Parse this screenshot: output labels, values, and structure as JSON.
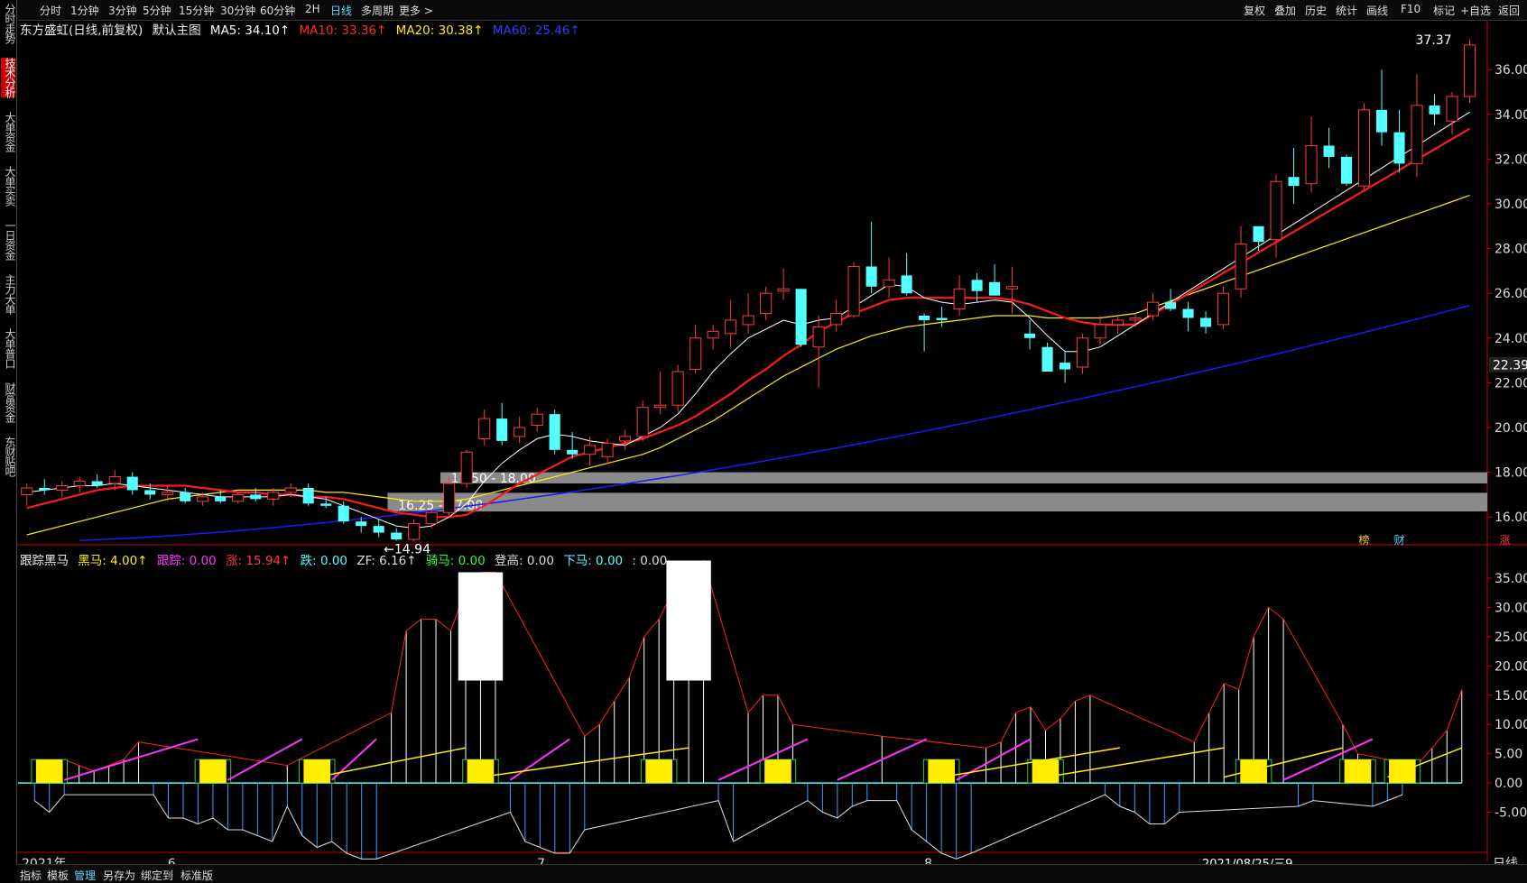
{
  "toolbar": {
    "left": [
      "分时",
      "1分钟",
      "3分钟",
      "5分钟",
      "15分钟",
      "30分钟",
      "60分钟",
      "2H",
      "日线",
      "多周期",
      "更多 >"
    ],
    "active": "日线",
    "right": [
      "复权",
      "叠加",
      "历史",
      "统计",
      "画线",
      "F10",
      "标记",
      "+自选",
      "返回"
    ]
  },
  "sidebar": {
    "items": [
      "分时走势",
      "技术分析",
      "大单资金",
      "大单买卖",
      "一日资金",
      "主力大单",
      "大单普口",
      "财富资金",
      "东财贴吧"
    ],
    "active": "技术分析"
  },
  "main_info": {
    "name": "东方盛虹(日线,前复权)",
    "template": "默认主图",
    "ma5_label": "MA5: 34.10↑",
    "ma10_label": "MA10: 33.36↑",
    "ma20_label": "MA20: 30.38↑",
    "ma60_label": "MA60: 25.46↑"
  },
  "indicator_info": {
    "name": "跟踪黑马",
    "heima": "黑马: 4.00↑",
    "genzong": "跟踪: 0.00",
    "zhang": "涨: 15.94↑",
    "die": "跌: 0.00",
    "zf": "ZF: 6.16↑",
    "qima": "骑马: 0.00",
    "denggao": "登高: 0.00",
    "xiama": "下马: 0.00",
    "blank": ": 0.00"
  },
  "bottom_bar": {
    "items": [
      "指标",
      "模板",
      "管理",
      "另存为",
      "绑定到",
      "标准版"
    ],
    "active": "管理"
  },
  "colors": {
    "up": "#ff3b3b",
    "down": "#54ffff",
    "ma5": "#ffffff",
    "ma10": "#ff1a1a",
    "ma20": "#ffee00",
    "ma60": "#1a1aff",
    "bg": "#000000"
  },
  "chart_data": [
    {
      "type": "candlestick",
      "title": "东方盛虹(日线,前复权)",
      "y_ticks": [
        16,
        18,
        20,
        22,
        24,
        26,
        28,
        30,
        32,
        34,
        36
      ],
      "current_price_label": "22.39",
      "high_label": "37.37",
      "low_label": "←14.94",
      "zone_labels": [
        "17.50 - 18.00",
        "16.25 - 17.08"
      ],
      "zones": [
        [
          17.5,
          18.0
        ],
        [
          16.25,
          17.08
        ]
      ],
      "x_labels": [
        "2021年",
        "6",
        "7",
        "8",
        "2021/08/25/三9"
      ],
      "x_label_index": [
        0,
        8,
        29,
        51,
        66
      ],
      "event_marks": [
        "榜",
        "财",
        "涨"
      ],
      "ohlc": [
        [
          17.0,
          17.5,
          16.5,
          17.3
        ],
        [
          17.3,
          17.7,
          17.0,
          17.2
        ],
        [
          17.2,
          17.6,
          16.9,
          17.4
        ],
        [
          17.4,
          17.8,
          17.1,
          17.6
        ],
        [
          17.6,
          17.9,
          17.3,
          17.4
        ],
        [
          17.5,
          18.1,
          17.2,
          17.8
        ],
        [
          17.8,
          18.0,
          17.0,
          17.2
        ],
        [
          17.2,
          17.5,
          16.8,
          17.0
        ],
        [
          17.0,
          17.4,
          16.7,
          17.1
        ],
        [
          17.1,
          17.3,
          16.6,
          16.7
        ],
        [
          16.7,
          17.1,
          16.5,
          16.9
        ],
        [
          16.9,
          17.2,
          16.6,
          16.7
        ],
        [
          16.7,
          17.1,
          16.6,
          17.0
        ],
        [
          17.0,
          17.3,
          16.7,
          16.8
        ],
        [
          16.8,
          17.3,
          16.5,
          17.1
        ],
        [
          17.1,
          17.5,
          16.9,
          17.3
        ],
        [
          17.3,
          17.5,
          16.5,
          16.6
        ],
        [
          16.6,
          16.9,
          16.4,
          16.5
        ],
        [
          16.5,
          16.7,
          15.7,
          15.8
        ],
        [
          15.8,
          16.0,
          15.3,
          15.6
        ],
        [
          15.6,
          15.9,
          15.1,
          15.3
        ],
        [
          15.3,
          15.5,
          14.94,
          15.0
        ],
        [
          15.0,
          15.9,
          14.9,
          15.7
        ],
        [
          15.7,
          16.3,
          15.5,
          16.2
        ],
        [
          16.2,
          17.8,
          16.0,
          17.5
        ],
        [
          17.5,
          19.0,
          17.3,
          18.9
        ],
        [
          19.5,
          20.8,
          19.2,
          20.4
        ],
        [
          20.4,
          21.1,
          19.2,
          19.4
        ],
        [
          19.6,
          20.5,
          19.3,
          20.0
        ],
        [
          20.1,
          20.9,
          19.8,
          20.6
        ],
        [
          20.6,
          20.8,
          18.8,
          19.0
        ],
        [
          19.0,
          19.8,
          18.6,
          18.8
        ],
        [
          18.8,
          19.6,
          18.3,
          19.2
        ],
        [
          18.7,
          19.5,
          18.4,
          19.3
        ],
        [
          19.4,
          19.9,
          19.0,
          19.6
        ],
        [
          19.6,
          21.2,
          19.4,
          20.9
        ],
        [
          20.9,
          22.5,
          20.6,
          21.0
        ],
        [
          21.0,
          22.8,
          20.7,
          22.5
        ],
        [
          22.6,
          24.6,
          22.4,
          24.0
        ],
        [
          24.0,
          24.6,
          23.5,
          24.3
        ],
        [
          24.2,
          25.7,
          23.6,
          24.8
        ],
        [
          24.6,
          26.0,
          24.2,
          25.0
        ],
        [
          25.1,
          26.3,
          24.8,
          26.0
        ],
        [
          26.1,
          27.1,
          25.7,
          26.2
        ],
        [
          26.2,
          26.2,
          23.6,
          23.7
        ],
        [
          23.6,
          25.0,
          21.8,
          24.5
        ],
        [
          24.6,
          25.7,
          24.3,
          25.1
        ],
        [
          25.0,
          27.4,
          24.9,
          27.2
        ],
        [
          27.2,
          29.2,
          26.0,
          26.3
        ],
        [
          26.3,
          27.6,
          25.8,
          26.6
        ],
        [
          26.8,
          27.8,
          25.9,
          26.0
        ],
        [
          25.0,
          25.1,
          23.4,
          24.8
        ],
        [
          24.9,
          25.4,
          24.5,
          24.8
        ],
        [
          25.3,
          26.8,
          25.0,
          26.2
        ],
        [
          26.6,
          26.9,
          25.6,
          26.1
        ],
        [
          26.5,
          27.3,
          25.9,
          25.9
        ],
        [
          26.2,
          27.2,
          25.1,
          26.3
        ],
        [
          24.2,
          24.8,
          23.5,
          24.0
        ],
        [
          23.6,
          23.8,
          22.6,
          22.5
        ],
        [
          22.9,
          23.4,
          22.0,
          22.6
        ],
        [
          22.7,
          24.2,
          22.4,
          24.0
        ],
        [
          24.0,
          25.0,
          23.7,
          24.6
        ],
        [
          24.6,
          25.0,
          24.2,
          24.8
        ],
        [
          24.8,
          25.1,
          24.5,
          24.9
        ]
      ],
      "ma5": [
        17.1,
        17.2,
        17.3,
        17.4,
        17.4,
        17.5,
        17.4,
        17.3,
        17.2,
        17.1,
        17.0,
        16.9,
        16.9,
        16.9,
        16.9,
        17.0,
        16.9,
        16.8,
        16.5,
        16.2,
        15.9,
        15.6,
        15.5,
        15.6,
        16.0,
        16.6,
        17.6,
        18.4,
        19.0,
        19.5,
        19.7,
        19.6,
        19.4,
        19.3,
        19.2,
        19.6,
        20.0,
        20.6,
        21.5,
        22.5,
        23.3,
        24.0,
        24.4,
        24.8,
        24.6,
        24.8,
        24.9,
        25.4,
        25.9,
        26.4,
        26.3,
        25.8,
        25.6,
        25.5,
        25.6,
        25.7,
        25.6,
        24.9,
        24.1,
        23.4,
        23.4,
        23.6,
        24.1,
        24.6
      ],
      "ma10": [
        16.4,
        16.6,
        16.8,
        17.0,
        17.2,
        17.3,
        17.4,
        17.4,
        17.4,
        17.4,
        17.3,
        17.2,
        17.1,
        17.1,
        17.0,
        17.0,
        16.9,
        16.9,
        16.8,
        16.6,
        16.4,
        16.2,
        16.1,
        16.0,
        16.0,
        16.1,
        16.5,
        17.0,
        17.5,
        17.9,
        18.3,
        18.7,
        18.9,
        19.1,
        19.3,
        19.5,
        19.8,
        20.1,
        20.5,
        21.0,
        21.5,
        22.1,
        22.6,
        23.2,
        23.7,
        24.3,
        24.7,
        25.1,
        25.4,
        25.7,
        25.8,
        25.8,
        25.8,
        25.8,
        25.8,
        25.8,
        25.7,
        25.5,
        25.2,
        24.9,
        24.7,
        24.6,
        24.6,
        24.6
      ],
      "ma20": [
        15.2,
        15.4,
        15.6,
        15.8,
        16.0,
        16.2,
        16.4,
        16.6,
        16.8,
        16.9,
        17.0,
        17.1,
        17.2,
        17.2,
        17.2,
        17.2,
        17.2,
        17.1,
        17.1,
        17.0,
        16.9,
        16.8,
        16.7,
        16.7,
        16.7,
        16.8,
        17.0,
        17.2,
        17.4,
        17.6,
        17.8,
        18.0,
        18.2,
        18.4,
        18.6,
        18.8,
        19.1,
        19.5,
        19.9,
        20.3,
        20.8,
        21.3,
        21.8,
        22.3,
        22.7,
        23.1,
        23.5,
        23.8,
        24.1,
        24.3,
        24.5,
        24.6,
        24.7,
        24.8,
        24.9,
        25.0,
        25.0,
        25.0,
        24.9,
        24.9,
        24.9,
        24.9,
        25.0,
        25.1
      ],
      "ma60_range": [
        14.9,
        25.46
      ],
      "ohlc_tail": [
        [
          25.0,
          26.0,
          24.8,
          25.6
        ],
        [
          25.6,
          26.2,
          25.2,
          25.3
        ],
        [
          25.3,
          25.6,
          24.3,
          24.9
        ],
        [
          24.9,
          25.2,
          24.2,
          24.5
        ],
        [
          24.6,
          26.3,
          24.4,
          26.0
        ],
        [
          26.2,
          29.0,
          25.8,
          28.2
        ],
        [
          29.0,
          29.0,
          27.9,
          28.3
        ],
        [
          28.4,
          31.3,
          27.6,
          31.0
        ],
        [
          31.2,
          32.5,
          30.0,
          30.8
        ],
        [
          30.9,
          33.9,
          30.5,
          32.6
        ],
        [
          32.6,
          33.4,
          31.6,
          32.1
        ],
        [
          32.1,
          32.2,
          30.8,
          30.9
        ],
        [
          30.8,
          34.5,
          30.6,
          34.2
        ],
        [
          34.2,
          36.0,
          32.6,
          33.2
        ],
        [
          33.2,
          34.2,
          31.4,
          31.8
        ],
        [
          31.8,
          35.8,
          31.2,
          34.4
        ],
        [
          34.4,
          34.9,
          33.5,
          34.0
        ],
        [
          33.7,
          35.0,
          33.1,
          34.8
        ],
        [
          34.8,
          37.37,
          34.5,
          37.1
        ]
      ]
    },
    {
      "type": "bar",
      "title": "跟踪黑马",
      "y_ticks": [
        -5.0,
        0.0,
        5.0,
        10.0,
        15.0,
        20.0,
        25.0,
        30.0,
        35.0
      ],
      "zhang": [
        0,
        2,
        4,
        3,
        2,
        3,
        4,
        7,
        0,
        0,
        0,
        0,
        0,
        0,
        0,
        0,
        0,
        3,
        0,
        0,
        0,
        0,
        0,
        0,
        12,
        26,
        28,
        28,
        26,
        33,
        36,
        36,
        0,
        0,
        0,
        0,
        0,
        8,
        10,
        14,
        18,
        25,
        28,
        33,
        35,
        38,
        0,
        0,
        12,
        15,
        15,
        10,
        0,
        0,
        0,
        0,
        0,
        8,
        0,
        0,
        0,
        0,
        0,
        0,
        6,
        7,
        12,
        13,
        9,
        11,
        14,
        15,
        0,
        0,
        0,
        0,
        0,
        0,
        7,
        12,
        17,
        16,
        25,
        30,
        28,
        0,
        0,
        0,
        10,
        5,
        0,
        0,
        0,
        3,
        6,
        9,
        15.94
      ],
      "die": [
        -3,
        -5,
        -2,
        0,
        0,
        0,
        0,
        0,
        -2,
        -6,
        -6,
        -7,
        -6,
        -8,
        -8,
        -9,
        -10,
        -4,
        -9,
        -11,
        -10,
        -12,
        -13,
        -13,
        0,
        0,
        0,
        0,
        0,
        0,
        0,
        0,
        -5,
        -10,
        -11,
        -12,
        -12,
        -8,
        0,
        0,
        0,
        0,
        0,
        0,
        0,
        0,
        -3,
        -10,
        0,
        0,
        0,
        0,
        -3,
        -5,
        -6,
        -4,
        -3,
        0,
        -3,
        -8,
        -10,
        -12,
        -13,
        -12,
        0,
        0,
        0,
        0,
        0,
        0,
        0,
        0,
        -2,
        -4,
        -5,
        -7,
        -7,
        -5,
        0,
        0,
        0,
        0,
        0,
        0,
        0,
        -4,
        -3,
        0,
        0,
        0,
        -4,
        -3,
        -2,
        0,
        0,
        0,
        0
      ],
      "heima_marks": [
        1,
        12,
        19,
        30,
        42,
        50,
        61,
        68,
        82,
        89,
        92
      ]
    }
  ]
}
